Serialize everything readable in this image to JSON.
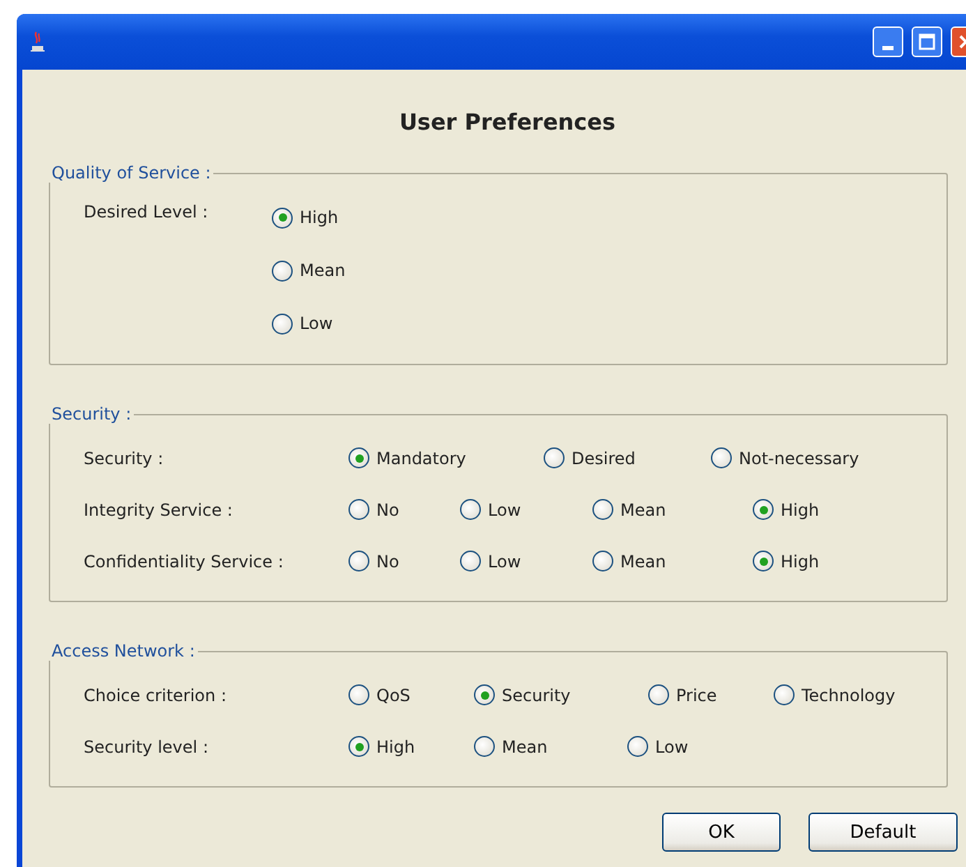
{
  "heading": "User Preferences",
  "groups": [
    {
      "title": "Quality of Service :",
      "kind": "stacked",
      "rows": [
        {
          "label": "Desired Level :",
          "options": [
            {
              "label": "High",
              "selected": true
            },
            {
              "label": "Mean",
              "selected": false
            },
            {
              "label": "Low",
              "selected": false
            }
          ]
        }
      ]
    },
    {
      "title": "Security :",
      "kind": "inline",
      "rows": [
        {
          "label": "Security :",
          "options": [
            {
              "label": "Mandatory",
              "selected": true
            },
            {
              "label": "Desired",
              "selected": false
            },
            {
              "label": "Not-necessary",
              "selected": false
            }
          ]
        },
        {
          "label": "Integrity Service :",
          "options": [
            {
              "label": "No",
              "selected": false
            },
            {
              "label": "Low",
              "selected": false
            },
            {
              "label": "Mean",
              "selected": false
            },
            {
              "label": "High",
              "selected": true
            }
          ]
        },
        {
          "label": "Confidentiality Service :",
          "options": [
            {
              "label": "No",
              "selected": false
            },
            {
              "label": "Low",
              "selected": false
            },
            {
              "label": "Mean",
              "selected": false
            },
            {
              "label": "High",
              "selected": true
            }
          ]
        }
      ]
    },
    {
      "title": "Access Network :",
      "kind": "inline",
      "rows": [
        {
          "label": "Choice criterion :",
          "options": [
            {
              "label": "QoS",
              "selected": false
            },
            {
              "label": "Security",
              "selected": true
            },
            {
              "label": "Price",
              "selected": false
            },
            {
              "label": "Technology",
              "selected": false
            }
          ]
        },
        {
          "label": "Security level :",
          "options": [
            {
              "label": "High",
              "selected": true
            },
            {
              "label": "Mean",
              "selected": false
            },
            {
              "label": "Low",
              "selected": false
            }
          ]
        }
      ]
    }
  ],
  "buttons": [
    "OK",
    "Default"
  ]
}
